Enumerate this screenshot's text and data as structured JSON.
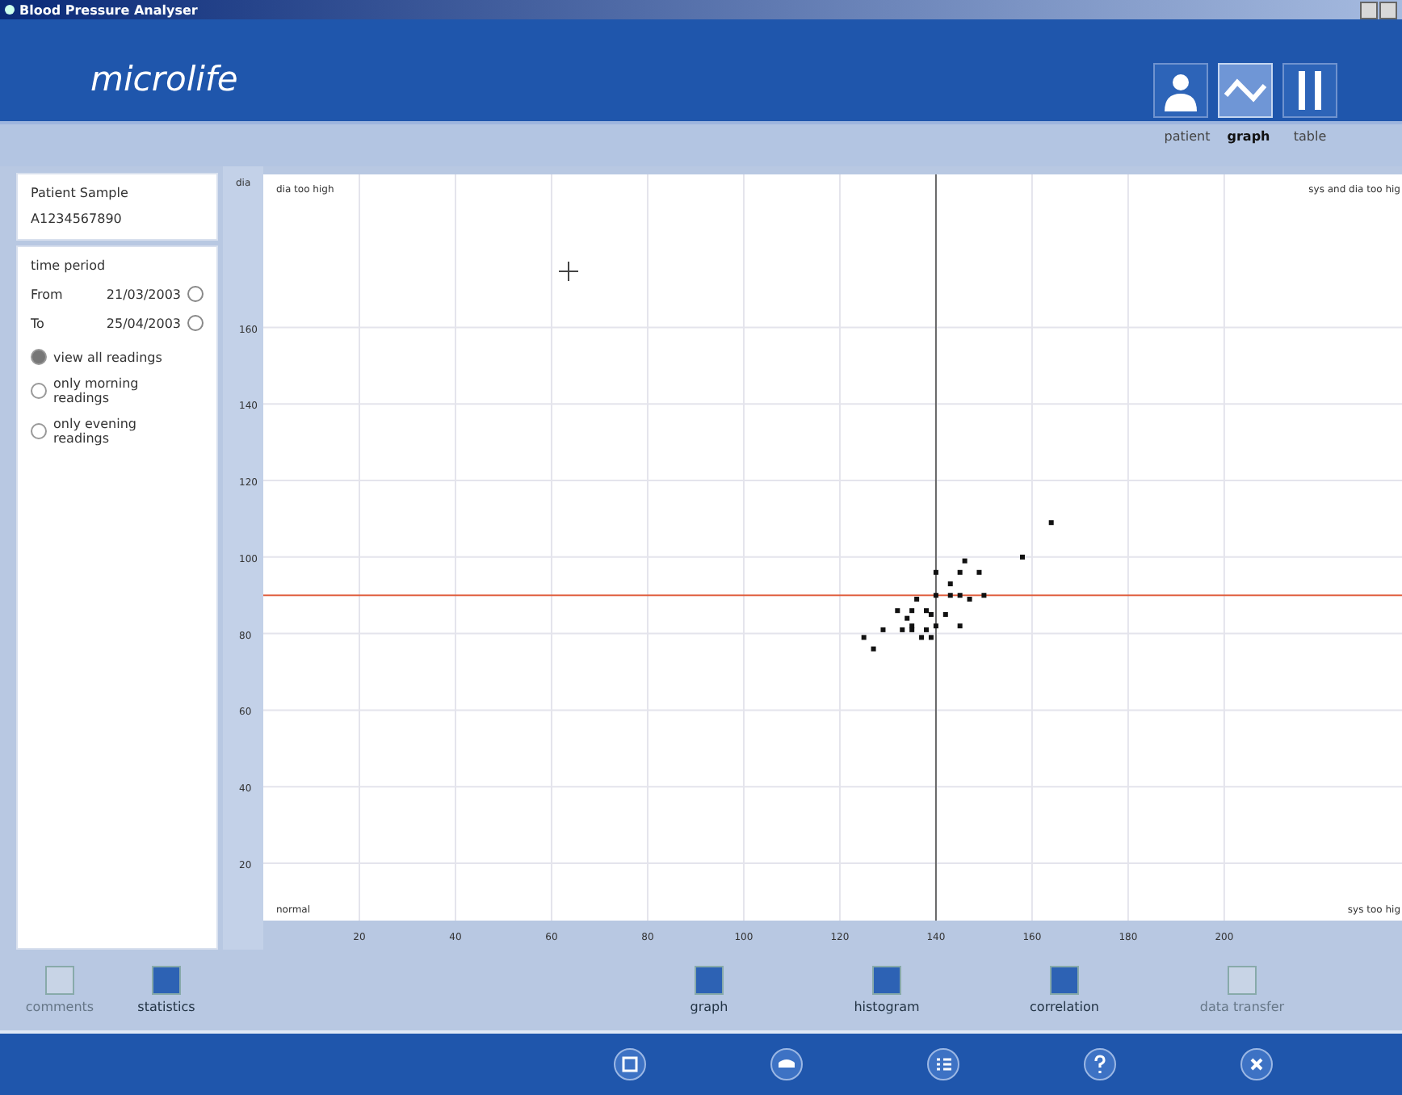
{
  "window": {
    "title": "Blood Pressure Analyser"
  },
  "header": {
    "logo": "microlife"
  },
  "tabs": [
    {
      "label": "patient",
      "selected": false
    },
    {
      "label": "graph",
      "selected": true
    },
    {
      "label": "table",
      "selected": false
    }
  ],
  "patient": {
    "name": "Patient Sample",
    "id": "A1234567890"
  },
  "time_period": {
    "title": "time period",
    "from_label": "From",
    "from": "21/03/2003",
    "to_label": "To",
    "to": "25/04/2003"
  },
  "options": [
    {
      "label": "view all readings",
      "selected": true
    },
    {
      "label": "only morning readings",
      "selected": false
    },
    {
      "label": "only evening readings",
      "selected": false
    }
  ],
  "chart": {
    "chart_data": {
      "type": "scatter",
      "ylabel": "dia",
      "xlim": [
        0,
        237
      ],
      "ylim": [
        5,
        200
      ],
      "grid": true,
      "xticks": [
        20,
        40,
        60,
        80,
        100,
        120,
        140,
        160,
        180,
        200
      ],
      "yticks": [
        20,
        40,
        60,
        80,
        100,
        120,
        140,
        160
      ],
      "x": [
        164,
        158,
        146,
        140,
        145,
        149,
        143,
        143,
        140,
        145,
        147,
        150,
        136,
        132,
        135,
        138,
        139,
        142,
        134,
        135,
        140,
        145,
        129,
        133,
        135,
        138,
        137,
        139,
        125,
        127
      ],
      "series": [
        {
          "color": "#111111",
          "values": [
            109,
            100,
            99,
            96,
            96,
            96,
            93,
            90,
            90,
            90,
            89,
            90,
            89,
            86,
            86,
            86,
            85,
            85,
            84,
            82,
            82,
            82,
            81,
            81,
            81,
            81,
            79,
            79,
            79,
            76
          ]
        }
      ],
      "ref_lines": [
        {
          "axis": "y",
          "value": 90,
          "color": "#e06040"
        },
        {
          "axis": "x",
          "value": 140,
          "color": "#666666"
        }
      ],
      "annotations": [
        "dia too high",
        "sys and dia too hig",
        "normal",
        "sys too hig"
      ]
    }
  },
  "toolbar": [
    {
      "label": "comments",
      "disabled": true
    },
    {
      "label": "statistics",
      "disabled": false
    },
    {
      "label": "graph",
      "disabled": false
    },
    {
      "label": "histogram",
      "disabled": false
    },
    {
      "label": "correlation",
      "disabled": false
    },
    {
      "label": "data transfer",
      "disabled": true
    }
  ]
}
